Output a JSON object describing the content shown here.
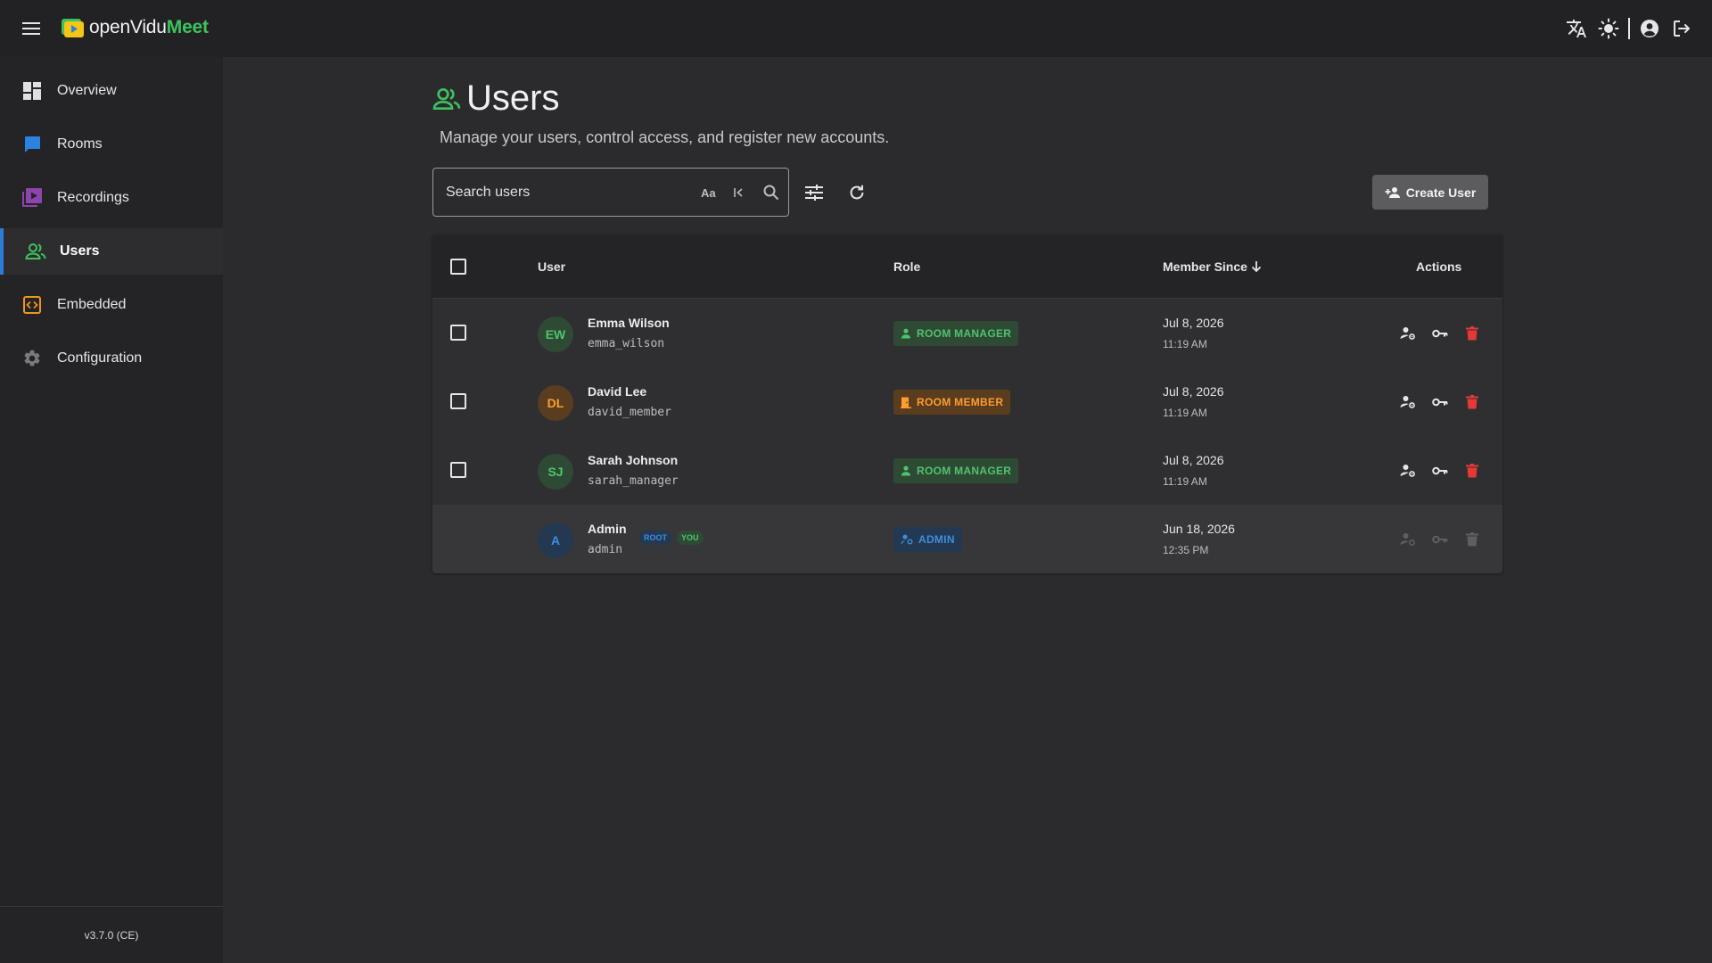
{
  "app": {
    "logo_part1": "openVidu",
    "logo_part2": "Meet",
    "version": "v3.7.0 (CE)"
  },
  "topbar": {
    "icons": [
      "translate-icon",
      "light-mode-icon",
      "account-icon",
      "logout-icon"
    ]
  },
  "sidebar": {
    "items": [
      {
        "label": "Overview",
        "icon": "dashboard-icon",
        "color": "#e0e0e0"
      },
      {
        "label": "Rooms",
        "icon": "chat-bubble-icon",
        "color": "#2b82e0"
      },
      {
        "label": "Recordings",
        "icon": "video-library-icon",
        "color": "#8e44ad"
      },
      {
        "label": "Users",
        "icon": "users-icon",
        "color": "#3cc35f",
        "active": true
      },
      {
        "label": "Embedded",
        "icon": "code-icon",
        "color": "#f0961e"
      },
      {
        "label": "Configuration",
        "icon": "gear-icon",
        "color": "#7a7a7a"
      }
    ]
  },
  "page": {
    "title": "Users",
    "subtitle": "Manage your users, control access, and register new accounts."
  },
  "search": {
    "placeholder": "Search users",
    "case_label": "Aa",
    "prefix_label": "I<"
  },
  "toolbar": {
    "create_label": "Create User"
  },
  "table": {
    "headers": {
      "user": "User",
      "role": "Role",
      "member_since": "Member Since",
      "actions": "Actions"
    },
    "rows": [
      {
        "initials": "EW",
        "name": "Emma Wilson",
        "handle": "emma_wilson",
        "role": "ROOM MANAGER",
        "date": "Jul 8, 2026",
        "time": "11:19 AM",
        "avatar_bg": "#2e4a35",
        "avatar_fg": "#4ec46b"
      },
      {
        "initials": "DL",
        "name": "David Lee",
        "handle": "david_member",
        "role": "ROOM MEMBER",
        "date": "Jul 8, 2026",
        "time": "11:19 AM",
        "avatar_bg": "#5a3d1e",
        "avatar_fg": "#ff9d2e"
      },
      {
        "initials": "SJ",
        "name": "Sarah Johnson",
        "handle": "sarah_manager",
        "role": "ROOM MANAGER",
        "date": "Jul 8, 2026",
        "time": "11:19 AM",
        "avatar_bg": "#2e4a35",
        "avatar_fg": "#4ec46b"
      },
      {
        "initials": "A",
        "name": "Admin",
        "handle": "admin",
        "role": "ADMIN",
        "date": "Jun 18, 2026",
        "time": "12:35 PM",
        "badges": [
          "ROOT",
          "YOU"
        ],
        "avatar_bg": "#233851",
        "avatar_fg": "#3d8ee0"
      }
    ]
  },
  "colors": {
    "accent": "#3cc35f",
    "nav_active": "#2b7cd3",
    "delete": "#e53935"
  }
}
